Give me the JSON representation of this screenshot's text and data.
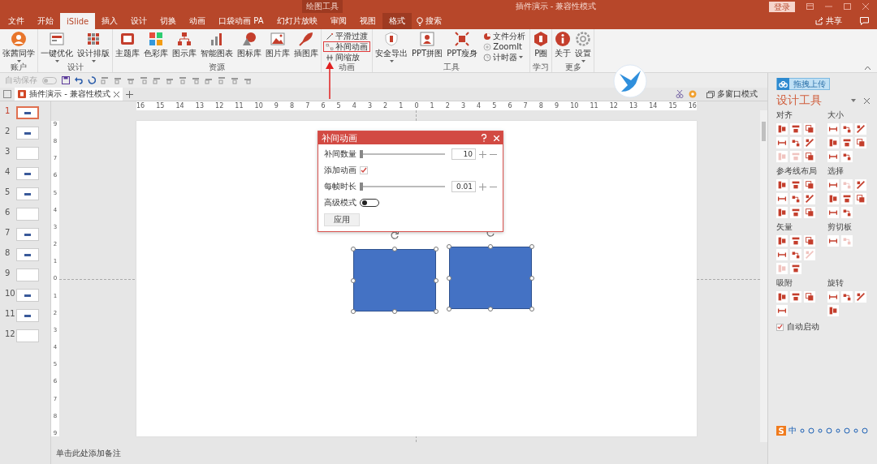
{
  "title_bar": {
    "context_label": "绘图工具",
    "title": "插件演示 - 兼容性模式",
    "login": "登录"
  },
  "tabs": [
    {
      "label": "文件",
      "selected": false,
      "context": false
    },
    {
      "label": "开始",
      "selected": false,
      "context": false
    },
    {
      "label": "iSlide",
      "selected": true,
      "context": false
    },
    {
      "label": "插入",
      "selected": false,
      "context": false
    },
    {
      "label": "设计",
      "selected": false,
      "context": false
    },
    {
      "label": "切换",
      "selected": false,
      "context": false
    },
    {
      "label": "动画",
      "selected": false,
      "context": false
    },
    {
      "label": "口袋动画 PA",
      "selected": false,
      "context": false
    },
    {
      "label": "幻灯片放映",
      "selected": false,
      "context": false
    },
    {
      "label": "审阅",
      "selected": false,
      "context": false
    },
    {
      "label": "视图",
      "selected": false,
      "context": false
    },
    {
      "label": "格式",
      "selected": false,
      "context": true
    }
  ],
  "search": {
    "label": "搜索"
  },
  "share": {
    "label": "共享"
  },
  "ribbon_groups": [
    {
      "label": "账户",
      "items": [
        {
          "kind": "large",
          "label": "张茜同学",
          "dropdown": true
        }
      ]
    },
    {
      "label": "设计",
      "items": [
        {
          "kind": "large",
          "label": "一键优化",
          "dropdown": true
        },
        {
          "kind": "large",
          "label": "设计排版",
          "dropdown": true
        }
      ]
    },
    {
      "label": "资源",
      "items": [
        {
          "kind": "large",
          "label": "主题库"
        },
        {
          "kind": "large",
          "label": "色彩库"
        },
        {
          "kind": "large",
          "label": "图示库"
        },
        {
          "kind": "large",
          "label": "智能图表"
        },
        {
          "kind": "large",
          "label": "图标库"
        },
        {
          "kind": "large",
          "label": "图片库"
        },
        {
          "kind": "large",
          "label": "插图库"
        }
      ]
    },
    {
      "label": "动画",
      "items": [
        {
          "kind": "small",
          "label": "平滑过渡"
        },
        {
          "kind": "small",
          "label": "补间动画",
          "highlighted": true
        },
        {
          "kind": "small",
          "label": "间缩放"
        }
      ]
    },
    {
      "label": "工具",
      "items": [
        {
          "kind": "large",
          "label": "安全导出",
          "dropdown": true
        },
        {
          "kind": "large",
          "label": "PPT拼图"
        },
        {
          "kind": "large",
          "label": "PPT瘦身"
        },
        {
          "kind": "small",
          "label": "文件分析"
        },
        {
          "kind": "small",
          "label": "ZoomIt"
        },
        {
          "kind": "small",
          "label": "计时器",
          "dropdown": true
        }
      ]
    },
    {
      "label": "学习",
      "items": [
        {
          "kind": "large",
          "label": "P圈"
        }
      ]
    },
    {
      "label": "更多",
      "items": [
        {
          "kind": "large",
          "label": "关于"
        },
        {
          "kind": "large",
          "label": "设置",
          "dropdown": true
        }
      ]
    }
  ],
  "quick_access": {
    "autosave_label": "自动保存",
    "autosave_on": false
  },
  "document_tab": {
    "title": "插件演示 - 兼容性模式"
  },
  "multi_window": {
    "label": "多窗口模式"
  },
  "slides": [
    {
      "number": "1",
      "selected": true
    },
    {
      "number": "2",
      "selected": false
    },
    {
      "number": "3",
      "selected": false
    },
    {
      "number": "4",
      "selected": false
    },
    {
      "number": "5",
      "selected": false
    },
    {
      "number": "6",
      "selected": false
    },
    {
      "number": "7",
      "selected": false
    },
    {
      "number": "8",
      "selected": false
    },
    {
      "number": "9",
      "selected": false
    },
    {
      "number": "10",
      "selected": false
    },
    {
      "number": "11",
      "selected": false
    },
    {
      "number": "12",
      "selected": false
    }
  ],
  "ruler_horizontal": [
    "16",
    "15",
    "14",
    "13",
    "12",
    "11",
    "10",
    "9",
    "8",
    "7",
    "6",
    "5",
    "4",
    "3",
    "2",
    "1",
    "0",
    "1",
    "2",
    "3",
    "4",
    "5",
    "6",
    "7",
    "8",
    "9",
    "10",
    "11",
    "12",
    "13",
    "14",
    "15",
    "16"
  ],
  "ruler_vertical": [
    "9",
    "8",
    "7",
    "6",
    "5",
    "4",
    "3",
    "2",
    "1",
    "0",
    "1",
    "2",
    "3",
    "4",
    "5",
    "6",
    "7",
    "8",
    "9"
  ],
  "dialog": {
    "title": "补间动画",
    "rows": [
      {
        "kind": "slider",
        "label": "补间数量",
        "level": 0,
        "value": "10"
      },
      {
        "kind": "checkbox",
        "label": "添加动画",
        "checked": true
      },
      {
        "kind": "slider",
        "label": "每帧时长",
        "level": 0,
        "value": "0.01"
      },
      {
        "kind": "toggle",
        "label": "高级模式",
        "on": false
      }
    ],
    "button": "应用"
  },
  "shapes": [
    {
      "kind": "rectangle",
      "selected": true
    },
    {
      "kind": "rectangle",
      "selected": true
    }
  ],
  "notes": {
    "placeholder": "单击此处添加备注"
  },
  "design_panel": {
    "upload_button": "拖拽上传",
    "title": "设计工具",
    "sections": [
      {
        "title": "对齐",
        "tools": [
          {
            "disabled": false
          },
          {
            "disabled": false
          },
          {
            "disabled": false
          },
          {
            "disabled": false
          },
          {
            "disabled": false
          },
          {
            "disabled": false
          },
          {
            "disabled": true
          },
          {
            "disabled": true
          },
          {
            "disabled": false
          }
        ]
      },
      {
        "title": "大小",
        "tools": [
          {
            "disabled": false
          },
          {
            "disabled": false
          },
          {
            "disabled": false
          },
          {
            "disabled": false
          },
          {
            "disabled": false
          },
          {
            "disabled": false
          },
          {
            "disabled": false
          },
          {
            "disabled": false
          }
        ]
      },
      {
        "title": "参考线布局",
        "tools": [
          {
            "disabled": false
          },
          {
            "disabled": false
          },
          {
            "disabled": false
          },
          {
            "disabled": false
          },
          {
            "disabled": false
          },
          {
            "disabled": false
          },
          {
            "disabled": false
          },
          {
            "disabled": false
          },
          {
            "disabled": false
          }
        ]
      },
      {
        "title": "选择",
        "tools": [
          {
            "disabled": false
          },
          {
            "disabled": true
          },
          {
            "disabled": false
          },
          {
            "disabled": false
          },
          {
            "disabled": false
          },
          {
            "disabled": false
          },
          {
            "disabled": false
          },
          {
            "disabled": false
          }
        ]
      },
      {
        "title": "矢量",
        "tools": [
          {
            "disabled": false
          },
          {
            "disabled": false
          },
          {
            "disabled": false
          },
          {
            "disabled": false
          },
          {
            "disabled": false
          },
          {
            "disabled": true
          },
          {
            "disabled": true
          },
          {
            "disabled": false
          }
        ]
      },
      {
        "title": "剪切板",
        "tools": [
          {
            "disabled": false
          },
          {
            "disabled": true
          }
        ]
      },
      {
        "title": "吸附",
        "tools": [
          {
            "disabled": false
          },
          {
            "disabled": false
          },
          {
            "disabled": false
          },
          {
            "disabled": false
          }
        ]
      },
      {
        "title": "旋转",
        "tools": [
          {
            "disabled": false
          },
          {
            "disabled": false
          },
          {
            "disabled": false
          },
          {
            "disabled": false
          }
        ]
      }
    ],
    "autostart": {
      "label": "自动启动",
      "checked": true
    }
  },
  "ime_bar": {
    "logo": "S",
    "mode": "中"
  }
}
